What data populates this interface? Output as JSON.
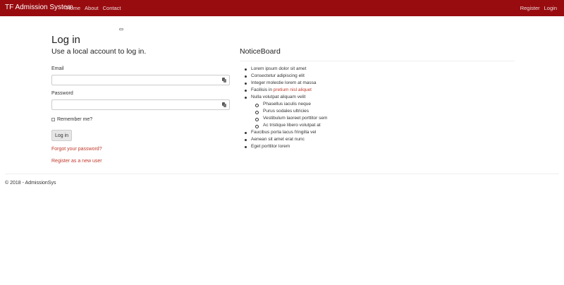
{
  "navbar": {
    "brand": "TF Admission System",
    "left_links": [
      "Home",
      "About",
      "Contact"
    ],
    "right_links": [
      "Register",
      "Login"
    ],
    "color": "#980c10"
  },
  "login": {
    "title": "Log in",
    "subtitle": "Use a local account to log in.",
    "email_label": "Email",
    "password_label": "Password",
    "remember_label": "Remember me?",
    "button_label": "Log in",
    "forgot_link": "Forgot your password?",
    "register_link": "Register as a new user"
  },
  "notice": {
    "title": "NoticeBoard",
    "items": [
      "Lorem ipsum dolor sit amet",
      "Consectetur adipiscing elit",
      "Integer molestie lorem at massa",
      "Facilisis in ",
      "Nulla volutpat aliquam velit"
    ],
    "item4_link": "pretium nisl aliquet",
    "sub_items": [
      "Phasellus iaculis neque",
      "Purus sodales ultricies",
      "Vestibulum laoreet porttitor sem",
      "Ac tristique libero volutpat at"
    ],
    "more_items": [
      "Faucibus porta lacus fringilla vel",
      "Aenean sit amet erat nunc",
      "Eget porttitor lorem"
    ]
  },
  "footer": {
    "text": "© 2018 - AdmissionSys"
  }
}
